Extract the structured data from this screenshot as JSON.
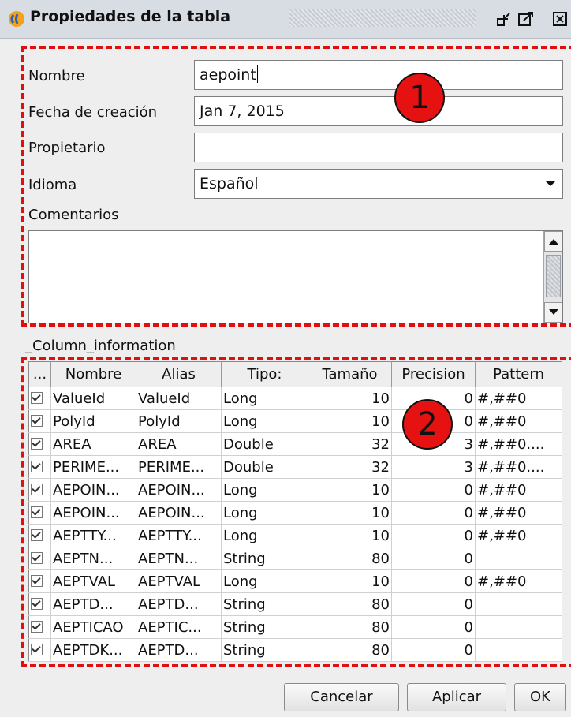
{
  "window": {
    "title": "Propiedades de la tabla"
  },
  "form": {
    "nombre_label": "Nombre",
    "nombre_value": "aepoint",
    "fecha_label": "Fecha de creación",
    "fecha_value": "Jan 7, 2015",
    "propietario_label": "Propietario",
    "propietario_value": "",
    "idioma_label": "Idioma",
    "idioma_value": "Español",
    "comentarios_label": "Comentarios",
    "comentarios_value": ""
  },
  "annotations": {
    "badge1": "1",
    "badge2": "2",
    "color": "#e01010"
  },
  "columns_section": {
    "label": "_Column_information",
    "headers": [
      "...",
      "Nombre",
      "Alias",
      "Tipo:",
      "Tamaño",
      "Precision",
      "Pattern"
    ],
    "rows": [
      {
        "checked": true,
        "nombre": "ValueId",
        "alias": "ValueId",
        "tipo": "Long",
        "tamano": "10",
        "precision": "0",
        "pattern": "#,##0"
      },
      {
        "checked": true,
        "nombre": "PolyId",
        "alias": "PolyId",
        "tipo": "Long",
        "tamano": "10",
        "precision": "0",
        "pattern": "#,##0"
      },
      {
        "checked": true,
        "nombre": "AREA",
        "alias": "AREA",
        "tipo": "Double",
        "tamano": "32",
        "precision": "3",
        "pattern": "#,##0...."
      },
      {
        "checked": true,
        "nombre": "PERIME...",
        "alias": "PERIME...",
        "tipo": "Double",
        "tamano": "32",
        "precision": "3",
        "pattern": "#,##0...."
      },
      {
        "checked": true,
        "nombre": "AEPOIN...",
        "alias": "AEPOIN...",
        "tipo": "Long",
        "tamano": "10",
        "precision": "0",
        "pattern": "#,##0"
      },
      {
        "checked": true,
        "nombre": "AEPOIN...",
        "alias": "AEPOIN...",
        "tipo": "Long",
        "tamano": "10",
        "precision": "0",
        "pattern": "#,##0"
      },
      {
        "checked": true,
        "nombre": "AEPTTY...",
        "alias": "AEPTTY...",
        "tipo": "Long",
        "tamano": "10",
        "precision": "0",
        "pattern": "#,##0"
      },
      {
        "checked": true,
        "nombre": "AEPTN...",
        "alias": "AEPTN...",
        "tipo": "String",
        "tamano": "80",
        "precision": "0",
        "pattern": ""
      },
      {
        "checked": true,
        "nombre": "AEPTVAL",
        "alias": "AEPTVAL",
        "tipo": "Long",
        "tamano": "10",
        "precision": "0",
        "pattern": "#,##0"
      },
      {
        "checked": true,
        "nombre": "AEPTD...",
        "alias": "AEPTD...",
        "tipo": "String",
        "tamano": "80",
        "precision": "0",
        "pattern": ""
      },
      {
        "checked": true,
        "nombre": "AEPTICAO",
        "alias": "AEPTIC...",
        "tipo": "String",
        "tamano": "80",
        "precision": "0",
        "pattern": ""
      },
      {
        "checked": true,
        "nombre": "AEPTDK...",
        "alias": "AEPTD...",
        "tipo": "String",
        "tamano": "80",
        "precision": "0",
        "pattern": ""
      }
    ]
  },
  "buttons": {
    "cancel": "Cancelar",
    "apply": "Aplicar",
    "ok": "OK"
  },
  "icons": {
    "app": "app-logo-icon",
    "restore": "restore-window-icon",
    "maximize": "maximize-window-icon",
    "close": "close-window-icon",
    "dropdown": "chevron-down-icon",
    "scroll_up": "arrow-up-icon",
    "scroll_down": "arrow-down-icon"
  }
}
